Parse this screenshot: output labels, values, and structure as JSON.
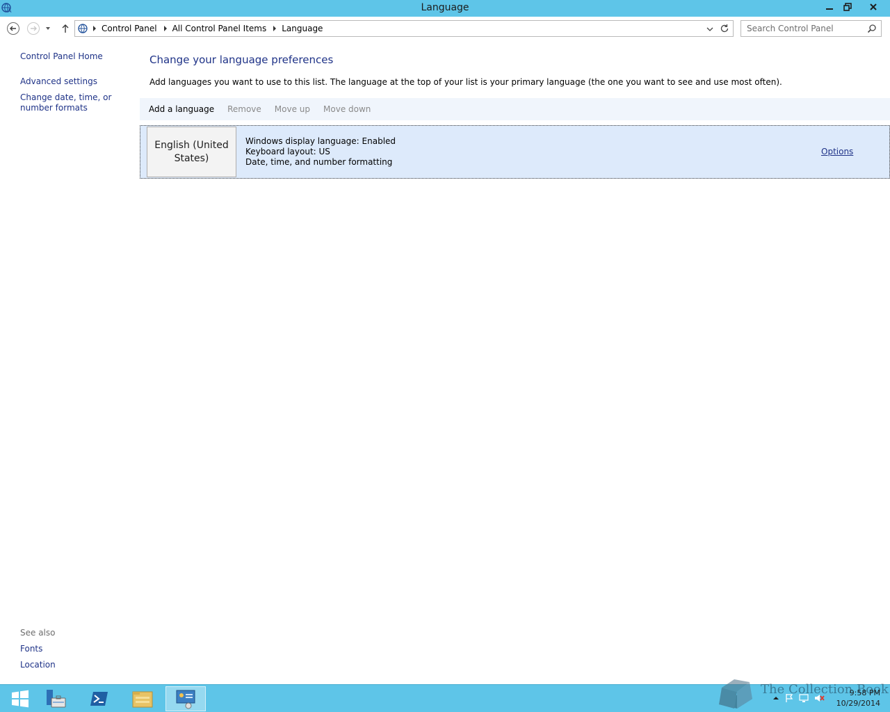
{
  "window": {
    "title": "Language"
  },
  "navigation": {
    "breadcrumbs": [
      "Control Panel",
      "All Control Panel Items",
      "Language"
    ],
    "search_placeholder": "Search Control Panel"
  },
  "left_nav": {
    "home": "Control Panel Home",
    "advanced": "Advanced settings",
    "date_formats": "Change date, time, or number formats",
    "see_also_title": "See also",
    "see_also": [
      "Fonts",
      "Location"
    ]
  },
  "main": {
    "title": "Change your language preferences",
    "description": "Add languages you want to use to this list. The language at the top of your list is your primary language (the one you want to see and use most often).",
    "toolbar": {
      "add": "Add a language",
      "remove": "Remove",
      "move_up": "Move up",
      "move_down": "Move down"
    },
    "languages": [
      {
        "name": "English (United States)",
        "details": [
          "Windows display language: Enabled",
          "Keyboard layout: US",
          "Date, time, and number formatting"
        ],
        "options": "Options"
      }
    ]
  },
  "taskbar": {
    "time": "9:58 PM",
    "date": "10/29/2014",
    "watermark": "The Collection Book"
  },
  "colors": {
    "titlebar": "#5ec5e8",
    "link": "#1e3287",
    "selection": "#ddeafb",
    "toolbar": "#f0f5fc"
  }
}
